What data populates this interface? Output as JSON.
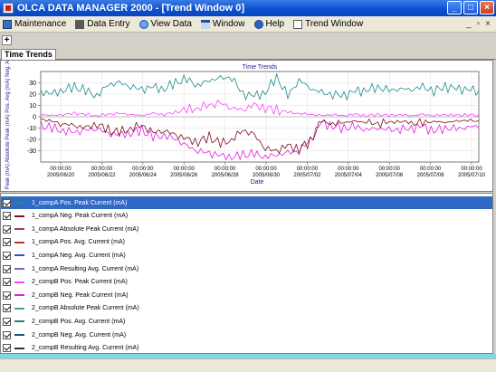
{
  "window": {
    "title": "OLCA DATA MANAGER 2000 - [Trend Window 0]"
  },
  "menu": {
    "items": [
      {
        "label": "Maintenance",
        "icon": "maintenance-icon"
      },
      {
        "label": "Data Entry",
        "icon": "data-entry-icon"
      },
      {
        "label": "View Data",
        "icon": "view-data-icon"
      },
      {
        "label": "Window",
        "icon": "window-icon"
      },
      {
        "label": "Help",
        "icon": "help-icon"
      },
      {
        "label": "Trend Window",
        "icon": "trend-window-icon"
      }
    ]
  },
  "toolbar": {
    "add_label": "+"
  },
  "tabs": [
    {
      "label": "Time Trends",
      "active": true
    }
  ],
  "chart_data": {
    "type": "line",
    "title": "Time Trends",
    "xlabel": "Date",
    "ylabel": "Peak (mA) Absolute Peak (mA) Pos. Avg (mA) Neg. Avg",
    "ylim": [
      -40,
      40
    ],
    "yticks": [
      30,
      20,
      10,
      0,
      -10,
      -20,
      -30
    ],
    "x_time_line": "00:00:00",
    "x_date_labels": [
      "2005/06/20",
      "2005/06/22",
      "2005/06/24",
      "2005/06/26",
      "2005/06/28",
      "2005/06/30",
      "2005/07/02",
      "2005/07/04",
      "2005/07/06",
      "2005/07/08",
      "2005/07/10"
    ],
    "grid": true,
    "series": [
      {
        "name": "1_compA Pos. Peak Current (mA)",
        "color": "#1a8a8a",
        "values": [
          22,
          20,
          24,
          26,
          23,
          19,
          28,
          30,
          27,
          24,
          26,
          25,
          30,
          33,
          28,
          32,
          34,
          35,
          20,
          18,
          22,
          35,
          18,
          33,
          25,
          21,
          20,
          19,
          22,
          24,
          26,
          23,
          25,
          24,
          26,
          23,
          27,
          24,
          25,
          22
        ]
      },
      {
        "name": "2_compB Neg. Peak Current (mA)",
        "color": "#e020e0",
        "values": [
          -8,
          -10,
          -12,
          -14,
          -12,
          -10,
          -15,
          -16,
          -14,
          -12,
          -18,
          -16,
          -20,
          -26,
          -30,
          -32,
          -35,
          -36,
          -34,
          -33,
          -35,
          -34,
          -32,
          -30,
          -20,
          -5,
          -8,
          -10,
          -9,
          -11,
          -10,
          -12,
          -11,
          -10,
          -9,
          -12,
          -10,
          -11,
          -9,
          -8
        ]
      },
      {
        "name": "1_compA Neg. Peak Current (mA)",
        "color": "#7a1020",
        "values": [
          -2,
          -4,
          -6,
          -8,
          -10,
          -6,
          -12,
          -14,
          -10,
          -8,
          -14,
          -12,
          -16,
          -20,
          -22,
          -18,
          -24,
          -20,
          -12,
          -16,
          -28,
          -30,
          -26,
          -28,
          -22,
          -4,
          -6,
          -5,
          -4,
          -5,
          -6,
          -5,
          -4,
          -5,
          -6,
          -4,
          -5,
          -4,
          -3,
          -4
        ]
      },
      {
        "name": "2_compB Pos. Peak Current (mA)",
        "color": "#ff40ff",
        "values": [
          2,
          1,
          2,
          3,
          2,
          1,
          2,
          3,
          2,
          1,
          3,
          2,
          4,
          6,
          8,
          10,
          12,
          8,
          6,
          10,
          8,
          6,
          4,
          3,
          2,
          1,
          2,
          1,
          2,
          1,
          2,
          1,
          2,
          1,
          2,
          1,
          2,
          1,
          2,
          1
        ]
      }
    ]
  },
  "series_list": [
    {
      "label": "1_compA Pos. Peak Current (mA)",
      "color": "#1a8a8a",
      "checked": true,
      "selected": true
    },
    {
      "label": "1_compA Neg. Peak Current (mA)",
      "color": "#7a1020",
      "checked": true,
      "selected": false
    },
    {
      "label": "1_compA Absolute Peak Current (mA)",
      "color": "#a04040",
      "checked": true,
      "selected": false
    },
    {
      "label": "1_compA Pos. Avg. Current (mA)",
      "color": "#c03030",
      "checked": true,
      "selected": false
    },
    {
      "label": "1_compA Neg. Avg. Current (mA)",
      "color": "#3050c0",
      "checked": true,
      "selected": false
    },
    {
      "label": "1_compA Resulting Avg. Current (mA)",
      "color": "#6a6ad0",
      "checked": true,
      "selected": false
    },
    {
      "label": "2_compB Pos. Peak Current (mA)",
      "color": "#ff40ff",
      "checked": true,
      "selected": false
    },
    {
      "label": "2_compB Neg. Peak Current (mA)",
      "color": "#e020e0",
      "checked": true,
      "selected": false
    },
    {
      "label": "2_compB Absolute Peak Current (mA)",
      "color": "#40a0a0",
      "checked": true,
      "selected": false
    },
    {
      "label": "2_compB Pos. Avg. Current (mA)",
      "color": "#208080",
      "checked": true,
      "selected": false
    },
    {
      "label": "2_compB Neg. Avg. Current (mA)",
      "color": "#205080",
      "checked": true,
      "selected": false
    },
    {
      "label": "2_compB Resulting Avg. Current (mA)",
      "color": "#303030",
      "checked": true,
      "selected": false
    }
  ]
}
